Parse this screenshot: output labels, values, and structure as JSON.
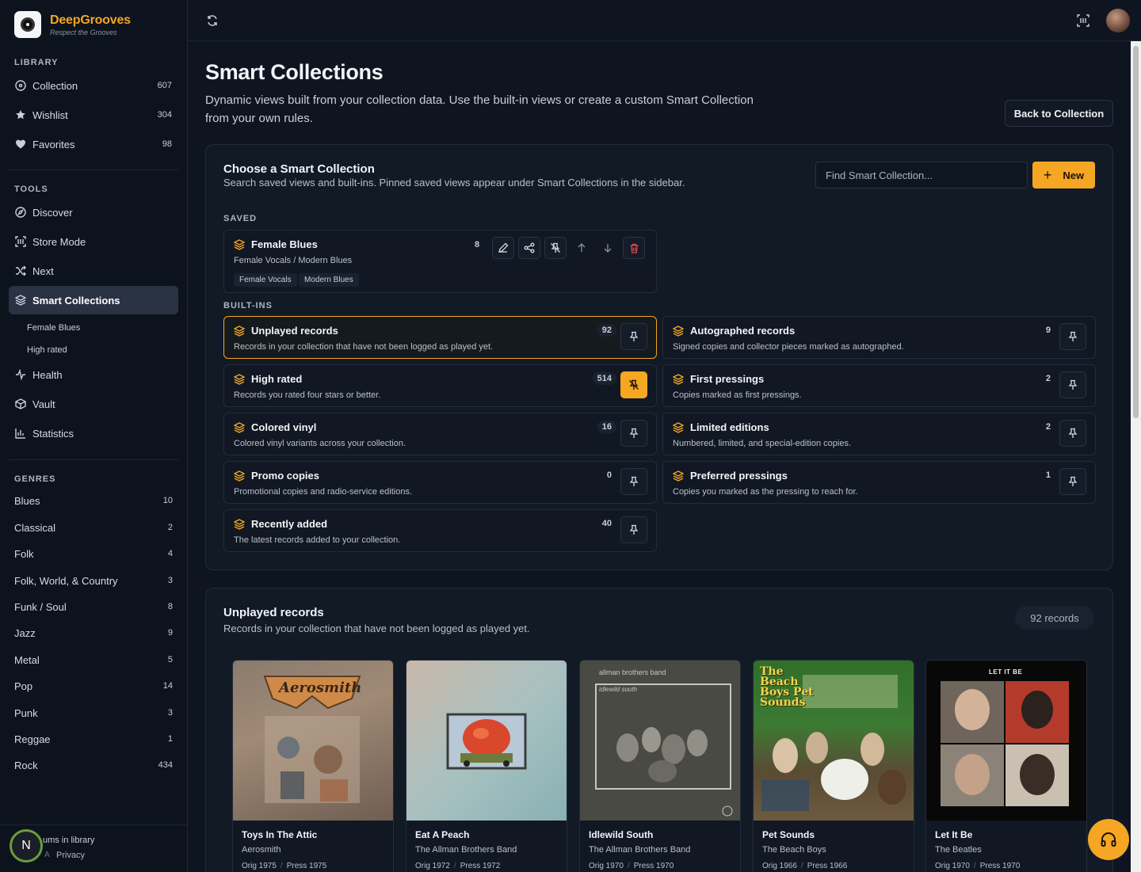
{
  "brand": {
    "name": "DeepGrooves",
    "tagline": "Respect the Grooves"
  },
  "sidebar": {
    "library_title": "LIBRARY",
    "library": [
      {
        "label": "Collection",
        "count": "607",
        "icon": "disc-icon"
      },
      {
        "label": "Wishlist",
        "count": "304",
        "icon": "star-icon"
      },
      {
        "label": "Favorites",
        "count": "98",
        "icon": "heart-icon"
      }
    ],
    "tools_title": "TOOLS",
    "tools": [
      {
        "label": "Discover",
        "icon": "compass-icon"
      },
      {
        "label": "Store Mode",
        "icon": "scan-icon"
      },
      {
        "label": "Next",
        "icon": "shuffle-icon"
      },
      {
        "label": "Smart Collections",
        "icon": "layers-icon",
        "active": true
      },
      {
        "label": "Health",
        "icon": "pulse-icon"
      },
      {
        "label": "Vault",
        "icon": "box-icon"
      },
      {
        "label": "Statistics",
        "icon": "bar-chart-icon"
      }
    ],
    "sub_items": [
      "Female Blues",
      "High rated"
    ],
    "genres_title": "GENRES",
    "genres": [
      {
        "label": "Blues",
        "count": "10"
      },
      {
        "label": "Classical",
        "count": "2"
      },
      {
        "label": "Folk",
        "count": "4"
      },
      {
        "label": "Folk, World, & Country",
        "count": "3"
      },
      {
        "label": "Funk / Soul",
        "count": "8"
      },
      {
        "label": "Jazz",
        "count": "9"
      },
      {
        "label": "Metal",
        "count": "5"
      },
      {
        "label": "Pop",
        "count": "14"
      },
      {
        "label": "Punk",
        "count": "3"
      },
      {
        "label": "Reggae",
        "count": "1"
      },
      {
        "label": "Rock",
        "count": "434"
      }
    ],
    "footer": {
      "avatar_letter": "N",
      "line1": "ums in library",
      "line2_prefix": "A",
      "line2": "Privacy"
    }
  },
  "page": {
    "title": "Smart Collections",
    "description": "Dynamic views built from your collection data. Use the built-in views or create a custom Smart Collection from your own rules.",
    "back_button": "Back to Collection"
  },
  "chooser": {
    "title": "Choose a Smart Collection",
    "subtitle": "Search saved views and built-ins. Pinned saved views appear under Smart Collections in the sidebar.",
    "search_placeholder": "Find Smart Collection...",
    "new_button": "New",
    "saved_label": "SAVED",
    "saved": [
      {
        "title": "Female Blues",
        "subtitle": "Female Vocals / Modern Blues",
        "count": "8",
        "chips": [
          "Female Vocals",
          "Modern Blues"
        ]
      }
    ],
    "builtins_label": "BUILT-INS",
    "builtins": [
      {
        "title": "Unplayed records",
        "subtitle": "Records in your collection that have not been logged as played yet.",
        "count": "92",
        "highlight": true,
        "pinned": false
      },
      {
        "title": "Autographed records",
        "subtitle": "Signed copies and collector pieces marked as autographed.",
        "count": "9",
        "pinned": false
      },
      {
        "title": "High rated",
        "subtitle": "Records you rated four stars or better.",
        "count": "514",
        "pinned": true
      },
      {
        "title": "First pressings",
        "subtitle": "Copies marked as first pressings.",
        "count": "2",
        "pinned": false
      },
      {
        "title": "Colored vinyl",
        "subtitle": "Colored vinyl variants across your collection.",
        "count": "16",
        "pinned": false
      },
      {
        "title": "Limited editions",
        "subtitle": "Numbered, limited, and special-edition copies.",
        "count": "2",
        "pinned": false
      },
      {
        "title": "Promo copies",
        "subtitle": "Promotional copies and radio-service editions.",
        "count": "0",
        "pinned": false
      },
      {
        "title": "Preferred pressings",
        "subtitle": "Copies you marked as the pressing to reach for.",
        "count": "1",
        "pinned": false
      },
      {
        "title": "Recently added",
        "subtitle": "The latest records added to your collection.",
        "count": "40",
        "pinned": false
      }
    ]
  },
  "results": {
    "title": "Unplayed records",
    "subtitle": "Records in your collection that have not been logged as played yet.",
    "count_label": "92 records",
    "albums": [
      {
        "title": "Toys In The Attic",
        "artist": "Aerosmith",
        "orig": "Orig 1975",
        "press": "Press 1975"
      },
      {
        "title": "Eat A Peach",
        "artist": "The Allman Brothers Band",
        "orig": "Orig 1972",
        "press": "Press 1972"
      },
      {
        "title": "Idlewild South",
        "artist": "The Allman Brothers Band",
        "orig": "Orig 1970",
        "press": "Press 1970"
      },
      {
        "title": "Pet Sounds",
        "artist": "The Beach Boys",
        "orig": "Orig 1966",
        "press": "Press 1966"
      },
      {
        "title": "Let It Be",
        "artist": "The Beatles",
        "orig": "Orig 1970",
        "press": "Press 1970"
      }
    ],
    "cover_text": {
      "aerosmith": "Aerosmith",
      "allman": "allman brothers band",
      "idlewild": "idlewild south",
      "beachboys": "The Beach Boys Pet Sounds",
      "letitbe": "LET IT BE"
    }
  },
  "colors": {
    "accent": "#f5a623",
    "bg": "#0f1520",
    "panel": "#121a26"
  }
}
